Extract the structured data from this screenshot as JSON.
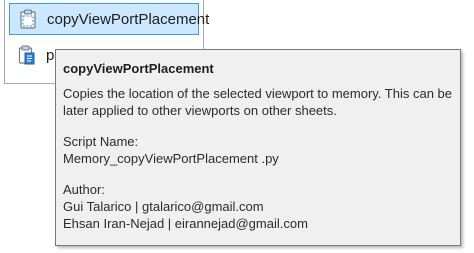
{
  "menu": {
    "items": [
      {
        "label": "copyViewPortPlacement",
        "icon": "clipboard-icon",
        "selected": true
      },
      {
        "label": "pa",
        "icon": "paste-icon",
        "selected": false
      }
    ]
  },
  "tooltip": {
    "title": "copyViewPortPlacement",
    "description": "Copies the location of the selected viewport to memory. This can be later applied to other viewports on other sheets.",
    "script_name_label": "Script Name:",
    "script_name": "Memory_copyViewPortPlacement .py",
    "author_label": "Author:",
    "authors": [
      "Gui Talarico | gtalarico@gmail.com",
      "Ehsan Iran-Nejad | eirannejad@gmail.com"
    ]
  },
  "colors": {
    "selection_fill": "#cce8ff",
    "selection_border": "#3d9ae8",
    "tooltip_bg": "#f0f0f0",
    "tooltip_border": "#7a7a7a"
  }
}
